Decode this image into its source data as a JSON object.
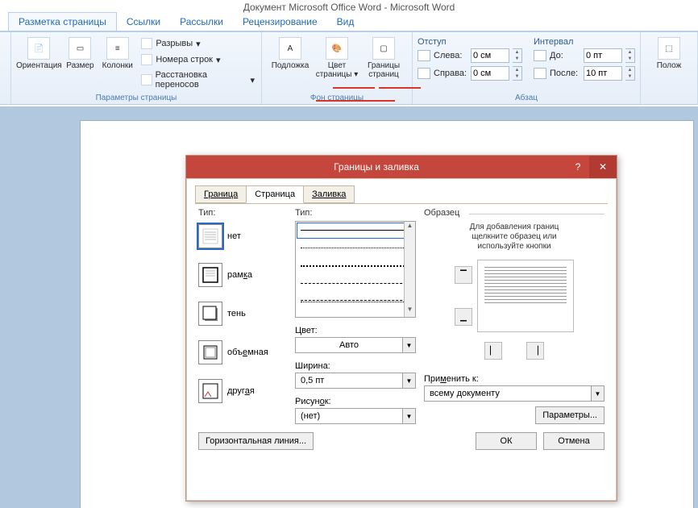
{
  "app": {
    "title": "Документ Microsoft Office Word - Microsoft Word"
  },
  "ribbonTabs": {
    "active": "Разметка страницы",
    "others": [
      "Ссылки",
      "Рассылки",
      "Рецензирование",
      "Вид"
    ]
  },
  "pageSetup": {
    "orientation": "Ориентация",
    "size": "Размер",
    "columns": "Колонки",
    "breaks": "Разрывы",
    "lineNumbers": "Номера строк",
    "hyphen": "Расстановка переносов",
    "groupLabel": "Параметры страницы"
  },
  "pageBg": {
    "watermark": "Подложка",
    "pageColor": "Цвет страницы",
    "borders": "Границы страниц",
    "groupLabel": "Фон страницы"
  },
  "indents": {
    "heading": "Отступ",
    "left": "Слева:",
    "right": "Справа:",
    "leftVal": "0 см",
    "rightVal": "0 см"
  },
  "spacing": {
    "heading": "Интервал",
    "before": "До:",
    "after": "После:",
    "beforeVal": "0 пт",
    "afterVal": "10 пт"
  },
  "paragraph": {
    "groupLabel": "Абзац"
  },
  "arrange": {
    "position": "Полож"
  },
  "dialog": {
    "title": "Границы и заливка",
    "tabs": {
      "border": "Граница",
      "page": "Страница",
      "shading": "Заливка"
    },
    "typeLabel": "Тип:",
    "types": {
      "none": "нет",
      "box": "рамка",
      "shadow": "тень",
      "threeD": "объемная",
      "custom": "другая"
    },
    "styleLabel": "Тип:",
    "colorLabel": "Цвет:",
    "colorVal": "Авто",
    "widthLabel": "Ширина:",
    "widthVal": "0,5 пт",
    "artLabel": "Рисунок:",
    "artVal": "(нет)",
    "previewLabel": "Образец",
    "previewNote1": "Для добавления границ",
    "previewNote2": "щелкните образец или",
    "previewNote3": "используйте кнопки",
    "applyLabel": "Применить к:",
    "applyVal": "всему документу",
    "paramsBtn": "Параметры...",
    "hline": "Горизонтальная линия...",
    "ok": "ОК",
    "cancel": "Отмена"
  }
}
